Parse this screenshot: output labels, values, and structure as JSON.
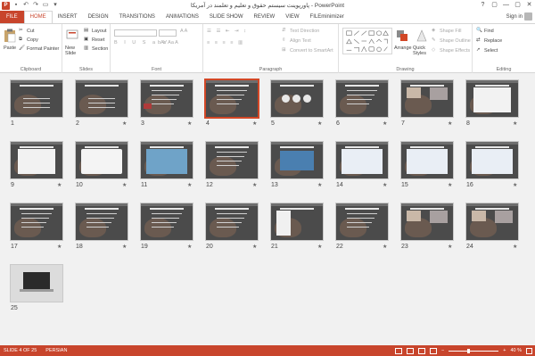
{
  "window": {
    "title": "پاورپوینت سیستم حقوق و تعلیم و تعلمند در آمریکا - PowerPoint",
    "app_icon": "P",
    "controls": [
      "?",
      "▢",
      "—",
      "▢",
      "✕"
    ]
  },
  "quick_access": [
    "save-icon",
    "undo-icon",
    "redo-icon",
    "start-from-beginning-icon",
    "customize-icon"
  ],
  "tabs": [
    "FILE",
    "HOME",
    "INSERT",
    "DESIGN",
    "TRANSITIONS",
    "ANIMATIONS",
    "SLIDE SHOW",
    "REVIEW",
    "VIEW",
    "FILEminimizer"
  ],
  "active_tab": "HOME",
  "account": {
    "signin": "Sign in"
  },
  "ribbon": {
    "clipboard": {
      "label": "Clipboard",
      "paste": "Paste",
      "cut": "Cut",
      "copy": "Copy",
      "format_painter": "Format Painter"
    },
    "slides": {
      "label": "Slides",
      "new_slide": "New Slide",
      "layout": "Layout",
      "reset": "Reset",
      "section": "Section"
    },
    "font": {
      "label": "Font"
    },
    "paragraph": {
      "label": "Paragraph",
      "text_direction": "Text Direction",
      "align_text": "Align Text",
      "convert_smartart": "Convert to SmartArt"
    },
    "drawing": {
      "label": "Drawing",
      "arrange": "Arrange",
      "quick_styles": "Quick Styles",
      "shape_fill": "Shape Fill",
      "shape_outline": "Shape Outline",
      "shape_effects": "Shape Effects"
    },
    "editing": {
      "label": "Editing",
      "find": "Find",
      "replace": "Replace",
      "select": "Select"
    }
  },
  "slides": [
    {
      "n": 1,
      "kind": "photo",
      "star": false
    },
    {
      "n": 2,
      "kind": "photo",
      "star": true
    },
    {
      "n": 3,
      "kind": "flag",
      "star": true
    },
    {
      "n": 4,
      "kind": "text",
      "star": true,
      "selected": true
    },
    {
      "n": 5,
      "kind": "shapes",
      "star": true
    },
    {
      "n": 6,
      "kind": "text",
      "star": true
    },
    {
      "n": 7,
      "kind": "photos",
      "star": true
    },
    {
      "n": 8,
      "kind": "chart",
      "star": true
    },
    {
      "n": 9,
      "kind": "chart",
      "star": true
    },
    {
      "n": 10,
      "kind": "whitebox",
      "star": true
    },
    {
      "n": 11,
      "kind": "map",
      "star": true
    },
    {
      "n": 12,
      "kind": "text",
      "star": true
    },
    {
      "n": 13,
      "kind": "usmap",
      "star": true
    },
    {
      "n": 14,
      "kind": "table",
      "star": true
    },
    {
      "n": 15,
      "kind": "table",
      "star": true
    },
    {
      "n": 16,
      "kind": "table",
      "star": true
    },
    {
      "n": 17,
      "kind": "text",
      "star": true
    },
    {
      "n": 18,
      "kind": "text",
      "star": true
    },
    {
      "n": 19,
      "kind": "text",
      "star": true
    },
    {
      "n": 20,
      "kind": "text",
      "star": true
    },
    {
      "n": 21,
      "kind": "diagram",
      "star": true
    },
    {
      "n": 22,
      "kind": "text",
      "star": true
    },
    {
      "n": 23,
      "kind": "photos",
      "star": true
    },
    {
      "n": 24,
      "kind": "photos",
      "star": true
    },
    {
      "n": 25,
      "kind": "laptop",
      "star": false
    }
  ],
  "status": {
    "slide": "SLIDE 4 OF 25",
    "language": "PERSIAN",
    "zoom": "40 %",
    "zoom_fraction": 0.4
  },
  "colors": {
    "accent": "#c8452c",
    "slide_bg": "#4b4b4b"
  }
}
